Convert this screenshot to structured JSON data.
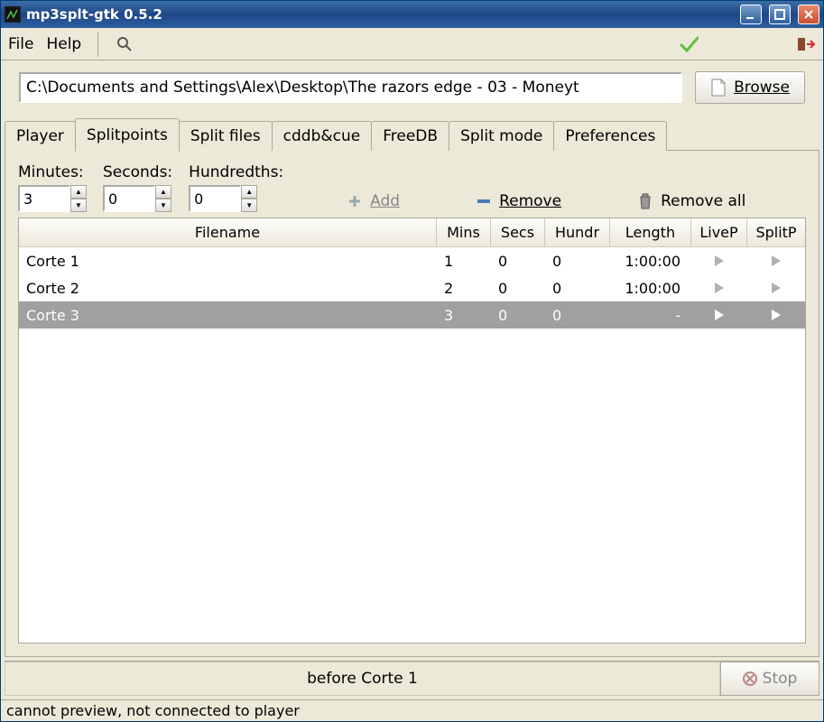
{
  "window": {
    "title": "mp3splt-gtk 0.5.2"
  },
  "menubar": {
    "file": "File",
    "help": "Help"
  },
  "pathbar": {
    "path": "C:\\Documents and Settings\\Alex\\Desktop\\The razors edge - 03 - Moneyt",
    "browse": "Browse"
  },
  "tabs": {
    "items": [
      {
        "label": "Player"
      },
      {
        "label": "Splitpoints"
      },
      {
        "label": "Split files"
      },
      {
        "label": "cddb&cue"
      },
      {
        "label": "FreeDB"
      },
      {
        "label": "Split mode"
      },
      {
        "label": "Preferences"
      }
    ],
    "active_index": 1
  },
  "splitpoints": {
    "minutes_label": "Minutes:",
    "seconds_label": "Seconds:",
    "hundredths_label": "Hundredths:",
    "minutes": "3",
    "seconds": "0",
    "hundredths": "0",
    "add": "Add",
    "remove": "Remove",
    "remove_all": "Remove all",
    "columns": {
      "filename": "Filename",
      "mins": "Mins",
      "secs": "Secs",
      "hundr": "Hundr",
      "length": "Length",
      "livep": "LiveP",
      "splitp": "SplitP"
    },
    "rows": [
      {
        "filename": "Corte 1",
        "mins": "1",
        "secs": "0",
        "hundr": "0",
        "length": "1:00:00",
        "selected": false
      },
      {
        "filename": "Corte 2",
        "mins": "2",
        "secs": "0",
        "hundr": "0",
        "length": "1:00:00",
        "selected": false
      },
      {
        "filename": "Corte 3",
        "mins": "3",
        "secs": "0",
        "hundr": "0",
        "length": "-",
        "selected": true
      }
    ]
  },
  "preview": {
    "label": "before Corte 1",
    "stop": "Stop"
  },
  "statusbar": {
    "text": "cannot preview, not connected to player"
  }
}
